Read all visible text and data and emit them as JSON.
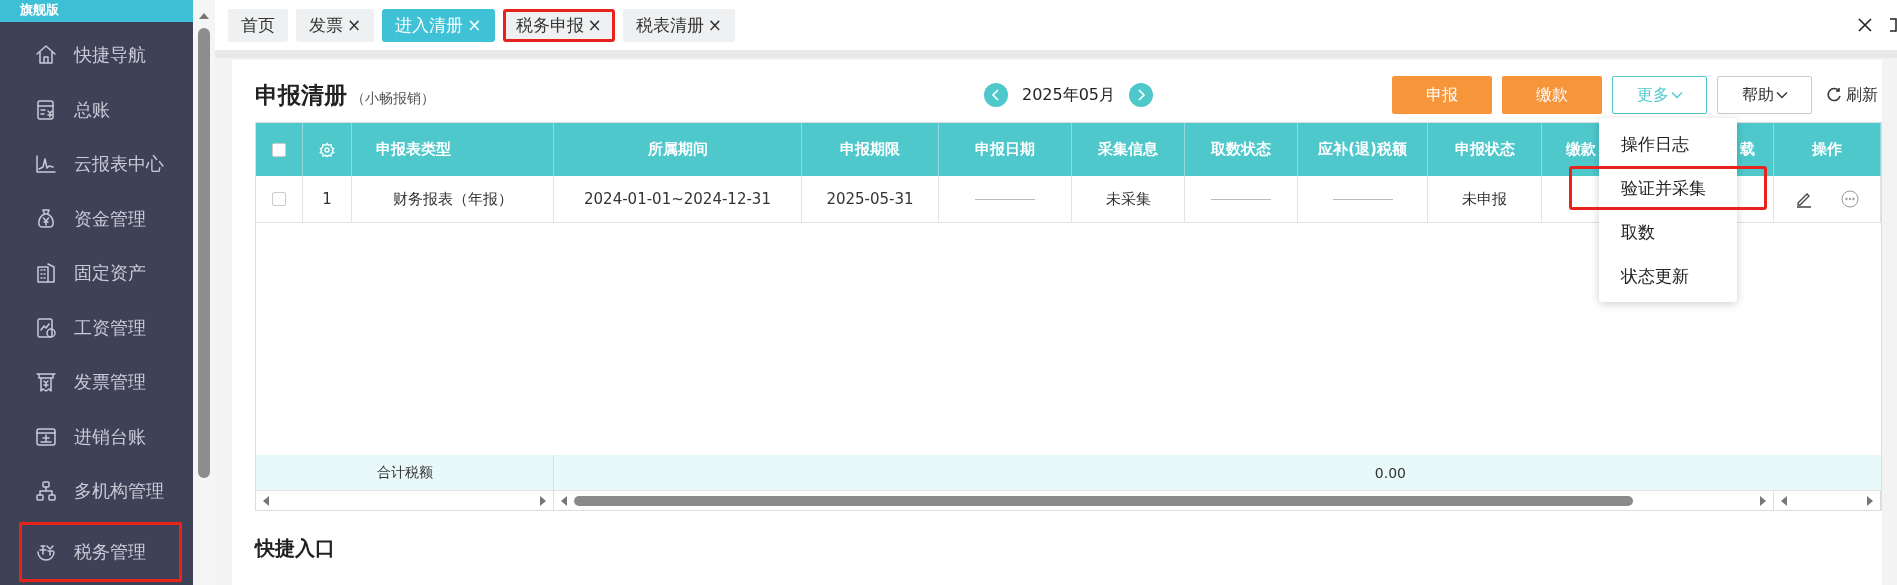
{
  "sidebar": {
    "edition": "旗舰版",
    "items": [
      {
        "label": "快捷导航",
        "highlighted": false
      },
      {
        "label": "总账",
        "highlighted": false
      },
      {
        "label": "云报表中心",
        "highlighted": false
      },
      {
        "label": "资金管理",
        "highlighted": false
      },
      {
        "label": "固定资产",
        "highlighted": false
      },
      {
        "label": "工资管理",
        "highlighted": false
      },
      {
        "label": "发票管理",
        "highlighted": false
      },
      {
        "label": "进销台账",
        "highlighted": false
      },
      {
        "label": "多机构管理",
        "highlighted": false
      },
      {
        "label": "税务管理",
        "highlighted": true
      }
    ]
  },
  "tabs": [
    {
      "label": "首页",
      "selected": false,
      "highlighted": false
    },
    {
      "label": "发票",
      "close": "×",
      "selected": false,
      "highlighted": false
    },
    {
      "label": "进入清册",
      "close": "×",
      "selected": true,
      "highlighted": false
    },
    {
      "label": "税务申报",
      "close": "×",
      "selected": false,
      "highlighted": true
    },
    {
      "label": "税表清册",
      "close": "×",
      "selected": false,
      "highlighted": false
    }
  ],
  "page": {
    "title": "申报清册",
    "subtitle": "（小畅报销）",
    "period": "2025年05月"
  },
  "actions": [
    {
      "label": "申报",
      "kind": "primary"
    },
    {
      "label": "缴款",
      "kind": "primary"
    },
    {
      "label": "更多",
      "kind": "dropdown"
    },
    {
      "label": "帮助",
      "kind": "plain-dropdown"
    },
    {
      "label": "刷新",
      "kind": "refresh"
    }
  ],
  "table": {
    "columns": [
      {
        "kind": "checkbox",
        "checked": false
      },
      {
        "kind": "settings"
      },
      {
        "kind": "text",
        "label": "申报表类型"
      },
      {
        "kind": "text",
        "label": "所属期间"
      },
      {
        "kind": "text",
        "label": "申报期限"
      },
      {
        "kind": "text",
        "label": "申报日期"
      },
      {
        "kind": "text",
        "label": "采集信息"
      },
      {
        "kind": "text",
        "label": "取数状态"
      },
      {
        "kind": "text",
        "label": "应补(退)税额"
      },
      {
        "kind": "text",
        "label": "申报状态"
      },
      {
        "kind": "text",
        "label": "缴款"
      },
      {
        "kind": "text",
        "label": "载"
      },
      {
        "kind": "text",
        "label": "操作"
      }
    ],
    "rows": [
      {
        "cells": [
          {
            "kind": "checkbox",
            "checked": false
          },
          {
            "kind": "text",
            "text": "1"
          },
          {
            "kind": "text",
            "text": "财务报表（年报）"
          },
          {
            "kind": "text",
            "text": "2024-01-01~2024-12-31"
          },
          {
            "kind": "text",
            "text": "2025-05-31"
          },
          {
            "kind": "dash"
          },
          {
            "kind": "text",
            "text": "未采集"
          },
          {
            "kind": "dash"
          },
          {
            "kind": "dash"
          },
          {
            "kind": "text",
            "text": "未申报"
          },
          {
            "kind": "empty"
          },
          {
            "kind": "empty"
          },
          {
            "kind": "actions"
          }
        ]
      }
    ],
    "totals": {
      "label": "合计税额",
      "amount": "0.00"
    }
  },
  "menu": {
    "items": [
      {
        "label": "操作日志",
        "highlighted": false
      },
      {
        "label": "验证并采集",
        "highlighted": true
      },
      {
        "label": "取数",
        "highlighted": false
      },
      {
        "label": "状态更新",
        "highlighted": false
      }
    ]
  },
  "quick_entry": {
    "title": "快捷入口"
  }
}
